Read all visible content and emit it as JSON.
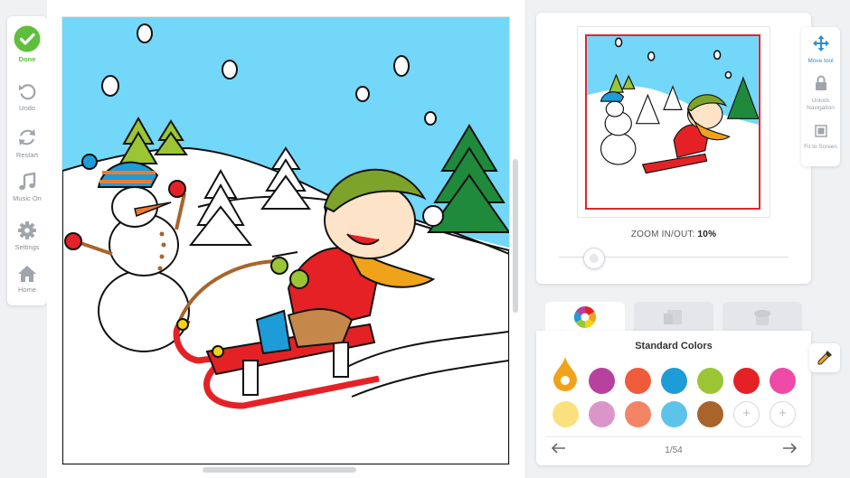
{
  "toolbar": {
    "done_label": "Done",
    "undo_label": "Undo",
    "restart_label": "Restart",
    "music_label": "Music On",
    "settings_label": "Settings",
    "home_label": "Home"
  },
  "navigator": {
    "zoom_label": "ZOOM IN/OUT:",
    "zoom_value": "10%",
    "zoom_level_percent": 10
  },
  "right_tools": {
    "move_label": "Move tool",
    "unlock_label": "Unlock Navigation",
    "fit_label": "Fit to Screen"
  },
  "palette": {
    "title": "Standard Colors",
    "page_indicator": "1/54",
    "selected_color": "#f0a31a",
    "colors_row1": [
      "#b7419e",
      "#ef5b3b",
      "#1e9cd7",
      "#9bc535",
      "#e42226",
      "#ee4aa8"
    ],
    "colors_row2": [
      "#fae17e",
      "#dc95c9",
      "#f48466",
      "#5ec3ea",
      "#a8642a"
    ],
    "add_symbol": "+"
  },
  "colors": {
    "done_green": "#5fbf3c",
    "viewport_red": "#e2252e",
    "sky": "#72d7f8"
  }
}
